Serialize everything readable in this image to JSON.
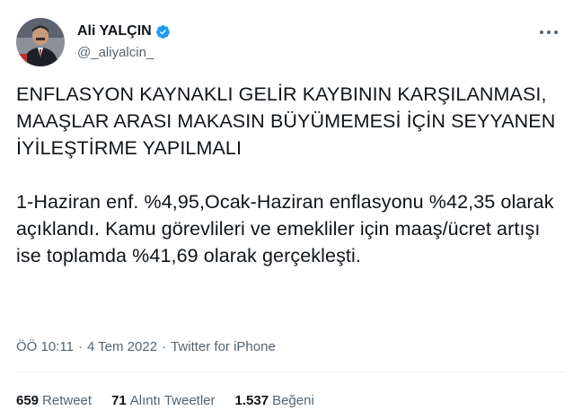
{
  "author": {
    "display_name": "Ali YALÇIN",
    "handle": "@_aliyalcin_",
    "verified_color": "#1d9bf0"
  },
  "tweet": {
    "headline": "ENFLASYON KAYNAKLI GELİR KAYBININ KARŞILANMASI, MAAŞLAR ARASI MAKASIN BÜYÜMEMESİ İÇİN SEYYANEN İYİLEŞTİRME YAPILMALI",
    "body": "1-Haziran enf. %4,95,Ocak-Haziran enflasyonu %42,35 olarak açıklandı. Kamu görevlileri ve emekliler için maaş/ücret artışı ise toplamda %41,69 olarak gerçekleşti."
  },
  "meta": {
    "time": "ÖÖ 10:11",
    "date": "4 Tem 2022",
    "separator": "·",
    "source": "Twitter for iPhone"
  },
  "stats": {
    "retweets_count": "659",
    "retweets_label": "Retweet",
    "quotes_count": "71",
    "quotes_label": "Alıntı Tweetler",
    "likes_count": "1.537",
    "likes_label": "Beğeni"
  },
  "icons": {
    "more": "more-options-icon",
    "verified": "verified-badge-icon"
  }
}
